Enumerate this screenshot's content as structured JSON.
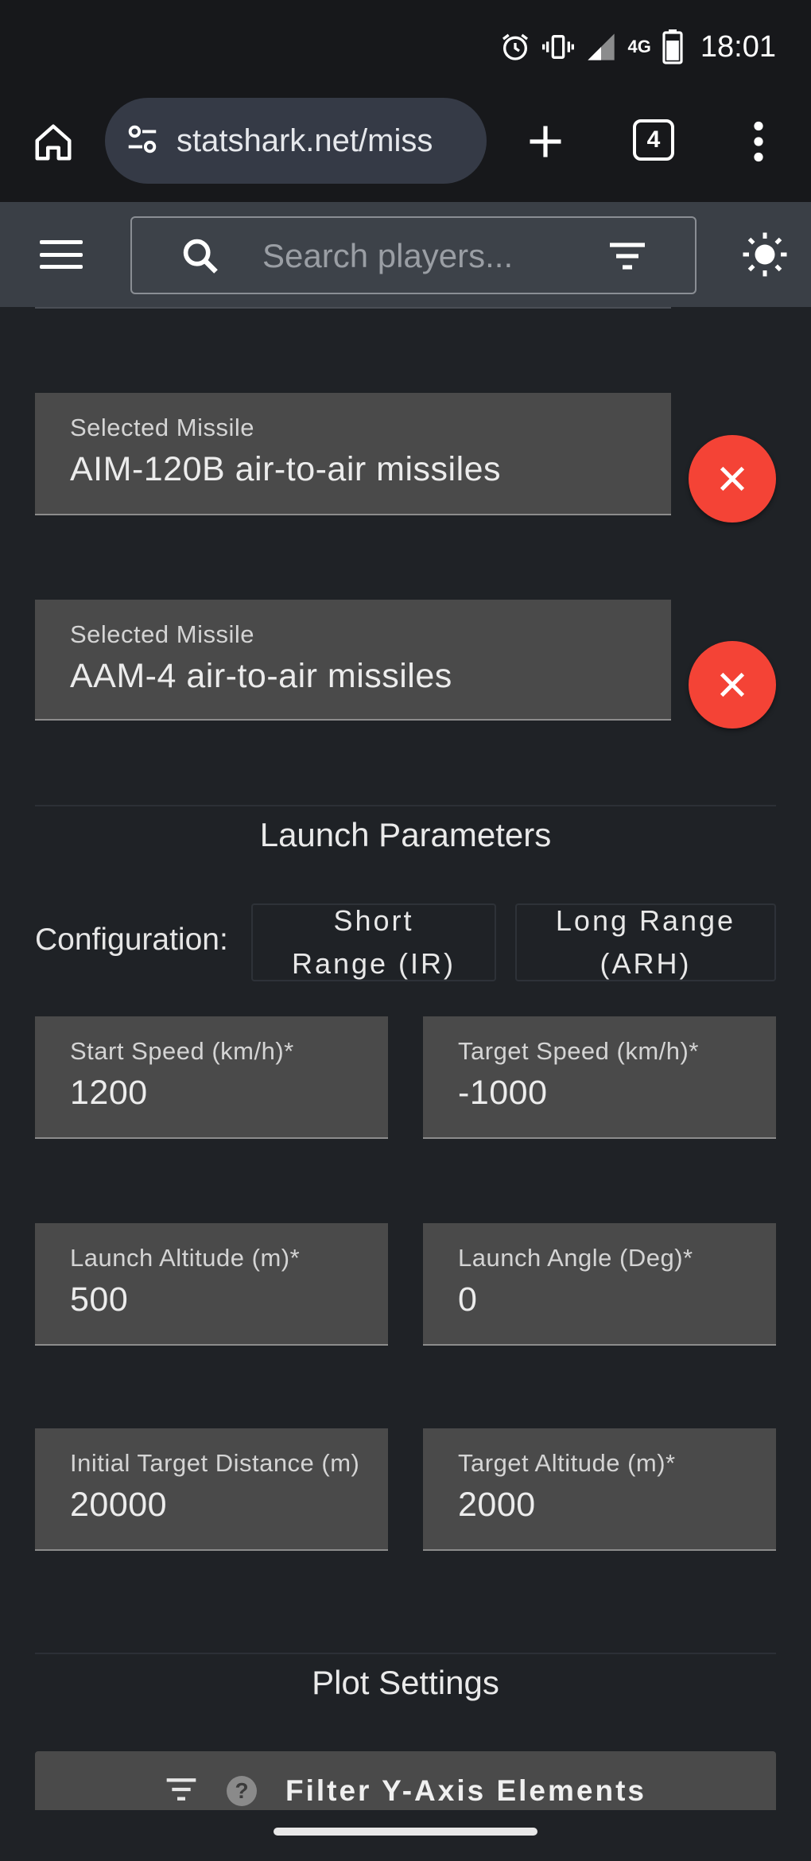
{
  "status_bar": {
    "time": "18:01",
    "network": "4G",
    "icons": [
      "alarm-icon",
      "vibrate-icon",
      "signal-icon",
      "battery-icon"
    ]
  },
  "browser": {
    "url": "statshark.net/miss",
    "tab_count": "4"
  },
  "app_bar": {
    "search_placeholder": "Search players..."
  },
  "missiles": [
    {
      "label": "Selected Missile",
      "value": "AIM-120B air-to-air missiles"
    },
    {
      "label": "Selected Missile",
      "value": "AAM-4 air-to-air missiles"
    }
  ],
  "launch": {
    "title": "Launch Parameters",
    "config_label": "Configuration:",
    "config_options": [
      "Short\nRange (IR)",
      "Long Range\n(ARH)"
    ],
    "fields": [
      {
        "label": "Start Speed (km/h)*",
        "value": "1200"
      },
      {
        "label": "Target Speed (km/h)*",
        "value": "-1000"
      },
      {
        "label": "Launch Altitude (m)*",
        "value": "500"
      },
      {
        "label": "Launch Angle (Deg)*",
        "value": "0"
      },
      {
        "label": "Initial Target Distance (m)",
        "value": "20000"
      },
      {
        "label": "Target Altitude (m)*",
        "value": "2000"
      }
    ]
  },
  "plot": {
    "title": "Plot Settings",
    "filter_button": "Filter Y-Axis Elements"
  },
  "colors": {
    "background": "#1f2226",
    "field_bg": "#4a4a4a",
    "remove_red": "#f44336",
    "app_bar": "#3a3f46"
  }
}
